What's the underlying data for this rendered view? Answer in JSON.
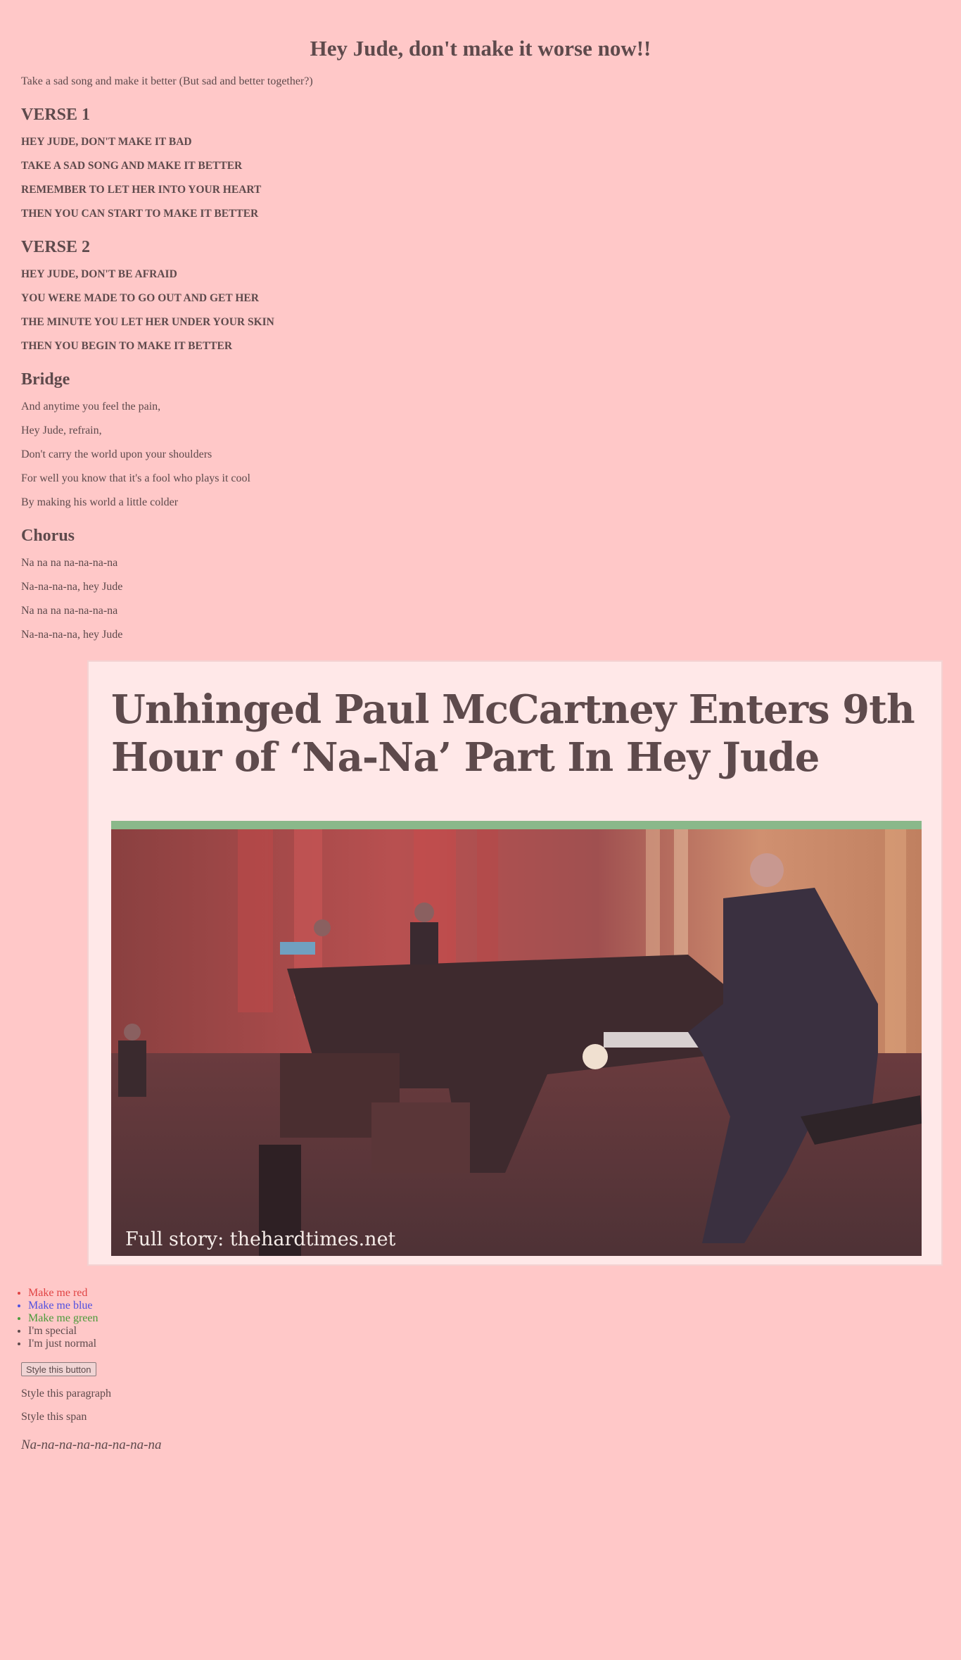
{
  "title": "Hey Jude, don't make it worse now!!",
  "intro": "Take a sad song and make it better (But sad and better together?)",
  "verse1": {
    "heading": "VERSE 1",
    "lines": [
      "HEY JUDE, DON'T MAKE IT BAD",
      "TAKE A SAD SONG AND MAKE IT BETTER",
      "REMEMBER TO LET HER INTO YOUR HEART",
      "THEN YOU CAN START TO MAKE IT BETTER"
    ]
  },
  "verse2": {
    "heading": "VERSE 2",
    "lines": [
      "HEY JUDE, DON'T BE AFRAID",
      "YOU WERE MADE TO GO OUT AND GET HER",
      "THE MINUTE YOU LET HER UNDER YOUR SKIN",
      "THEN YOU BEGIN TO MAKE IT BETTER"
    ]
  },
  "bridge": {
    "heading": "Bridge",
    "lines": [
      "And anytime you feel the pain,",
      "Hey Jude, refrain,",
      "Don't carry the world upon your shoulders",
      "For well you know that it's a fool who plays it cool",
      "By making his world a little colder"
    ]
  },
  "chorus": {
    "heading": "Chorus",
    "lines": [
      "Na na na na-na-na-na",
      "Na-na-na-na, hey Jude",
      "Na na na na-na-na-na",
      "Na-na-na-na, hey Jude"
    ]
  },
  "card": {
    "headline": "Unhinged Paul McCartney Enters 9th Hour of ‘Na-Na’ Part In Hey Jude",
    "caption": "Full story: thehardtimes.net"
  },
  "list": [
    {
      "label": "Make me red",
      "color": "#e04444"
    },
    {
      "label": "Make me blue",
      "color": "#5050e0"
    },
    {
      "label": "Make me green",
      "color": "#4a9a3a"
    },
    {
      "label": "I'm special",
      "color": "#5e4a4c"
    },
    {
      "label": "I'm just normal",
      "color": "#5e4a4c"
    }
  ],
  "button_label": "Style this button",
  "paragraph": "Style this paragraph",
  "span": "Style this span",
  "nana": "Na-na-na-na-na-na-na-na",
  "colors": {
    "background": "#ffc8c8",
    "text": "#5e4a4c",
    "card": "#ffe8e8",
    "photo_bar": "#8ab88a"
  }
}
